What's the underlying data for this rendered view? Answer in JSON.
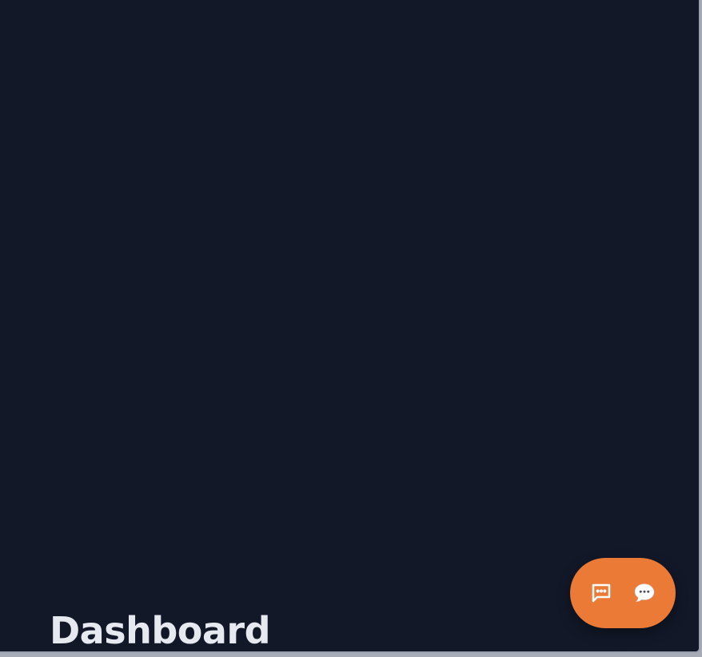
{
  "page": {
    "title": "Dashboard"
  },
  "chat_launcher": {
    "icons": [
      "message-square-icon",
      "speech-bubble-icon"
    ],
    "accent_color": "#ea7a36"
  },
  "colors": {
    "background": "#121828",
    "title_text": "#e6e9ef",
    "frame": "#9aa1ae"
  }
}
